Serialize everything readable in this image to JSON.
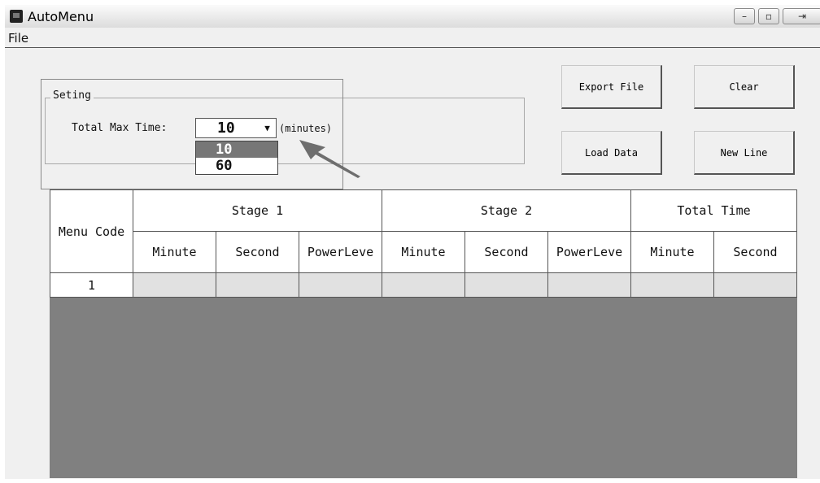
{
  "window": {
    "title": "AutoMenu",
    "controls": {
      "minimize": "–",
      "maximize": "▫",
      "close": "⇥"
    }
  },
  "menubar": {
    "file_label": "File"
  },
  "setting": {
    "group_label": "Seting",
    "max_time_label": "Total Max Time:",
    "combo_value": "10",
    "unit_label": "(minutes)",
    "options": [
      "10",
      "60"
    ],
    "selected_option": "10"
  },
  "buttons": {
    "export": "Export File",
    "clear": "Clear",
    "load": "Load Data",
    "new_line": "New Line"
  },
  "table": {
    "menu_code_header": "Menu Code",
    "groups": [
      "Stage 1",
      "Stage 2",
      "Total Time"
    ],
    "columns": [
      "Minute",
      "Second",
      "PowerLeve",
      "Minute",
      "Second",
      "PowerLeve",
      "Minute",
      "Second"
    ],
    "rows": [
      {
        "code": "1",
        "cells": [
          "",
          "",
          "",
          "",
          "",
          "",
          "",
          ""
        ]
      }
    ]
  },
  "colors": {
    "grid_background": "#808080",
    "row_fill": "#e1e1e1",
    "arrow": "#6e6e6e"
  }
}
